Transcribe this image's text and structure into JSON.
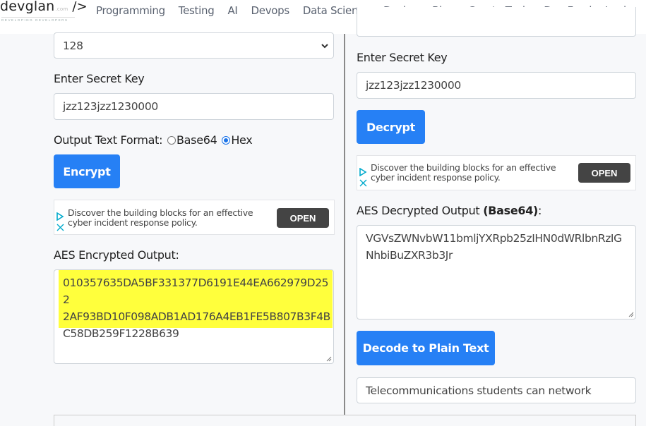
{
  "header": {
    "logo": {
      "main": "devglan",
      "com": ".com",
      "slash": "/>",
      "tagline": "DEVELOPING DEVELOPERS"
    },
    "nav": [
      {
        "label": "Programming"
      },
      {
        "label": "Testing"
      },
      {
        "label": "AI"
      },
      {
        "label": "Devops"
      },
      {
        "label": "Data Science"
      },
      {
        "label": "Design"
      },
      {
        "label": "Blog"
      },
      {
        "label": "Crypto Tools"
      },
      {
        "label": "Dev Feed"
      },
      {
        "label": "Login"
      }
    ]
  },
  "encrypt": {
    "key_size_value": "128",
    "secret_key_label": "Enter Secret Key",
    "secret_key_value": "jzz123jzz1230000",
    "output_format_label": "Output Text Format:",
    "format_options": [
      {
        "label": "Base64",
        "checked": false
      },
      {
        "label": "Hex",
        "checked": true
      }
    ],
    "encrypt_button": "Encrypt",
    "ad": {
      "text_line1": "Discover the building blocks for an effective",
      "text_line2": "cyber incident response policy.",
      "button": "OPEN"
    },
    "output_label": "AES Encrypted Output:",
    "output_lines": [
      "010357635DA5BF331377D6191E44EA662979D252",
      "2AF93BD10F098ADB1AD176A4EB1FE5B807B3F4B",
      "C58DB259F1228B639"
    ],
    "highlight_color": "#ffff3c"
  },
  "decrypt": {
    "secret_key_label": "Enter Secret Key",
    "secret_key_value": "jzz123jzz1230000",
    "decrypt_button": "Decrypt",
    "ad": {
      "text_line1": "Discover the building blocks for an effective",
      "text_line2": "cyber incident response policy.",
      "button": "OPEN"
    },
    "output_label_prefix": "AES Decrypted Output ",
    "output_label_bold": "(Base64)",
    "output_label_suffix": ":",
    "output_lines": [
      "VGVsZWNvbW11bmljYXRpb25zIHN0dWRlbnRzIG",
      "NhbiBuZXR3b3Jr"
    ],
    "decode_button": "Decode to Plain Text",
    "plain_text_value": "Telecommunications students can network"
  },
  "colors": {
    "primary": "#2680f5",
    "ad_button": "#444444",
    "ad_icon": "#00aacc"
  }
}
